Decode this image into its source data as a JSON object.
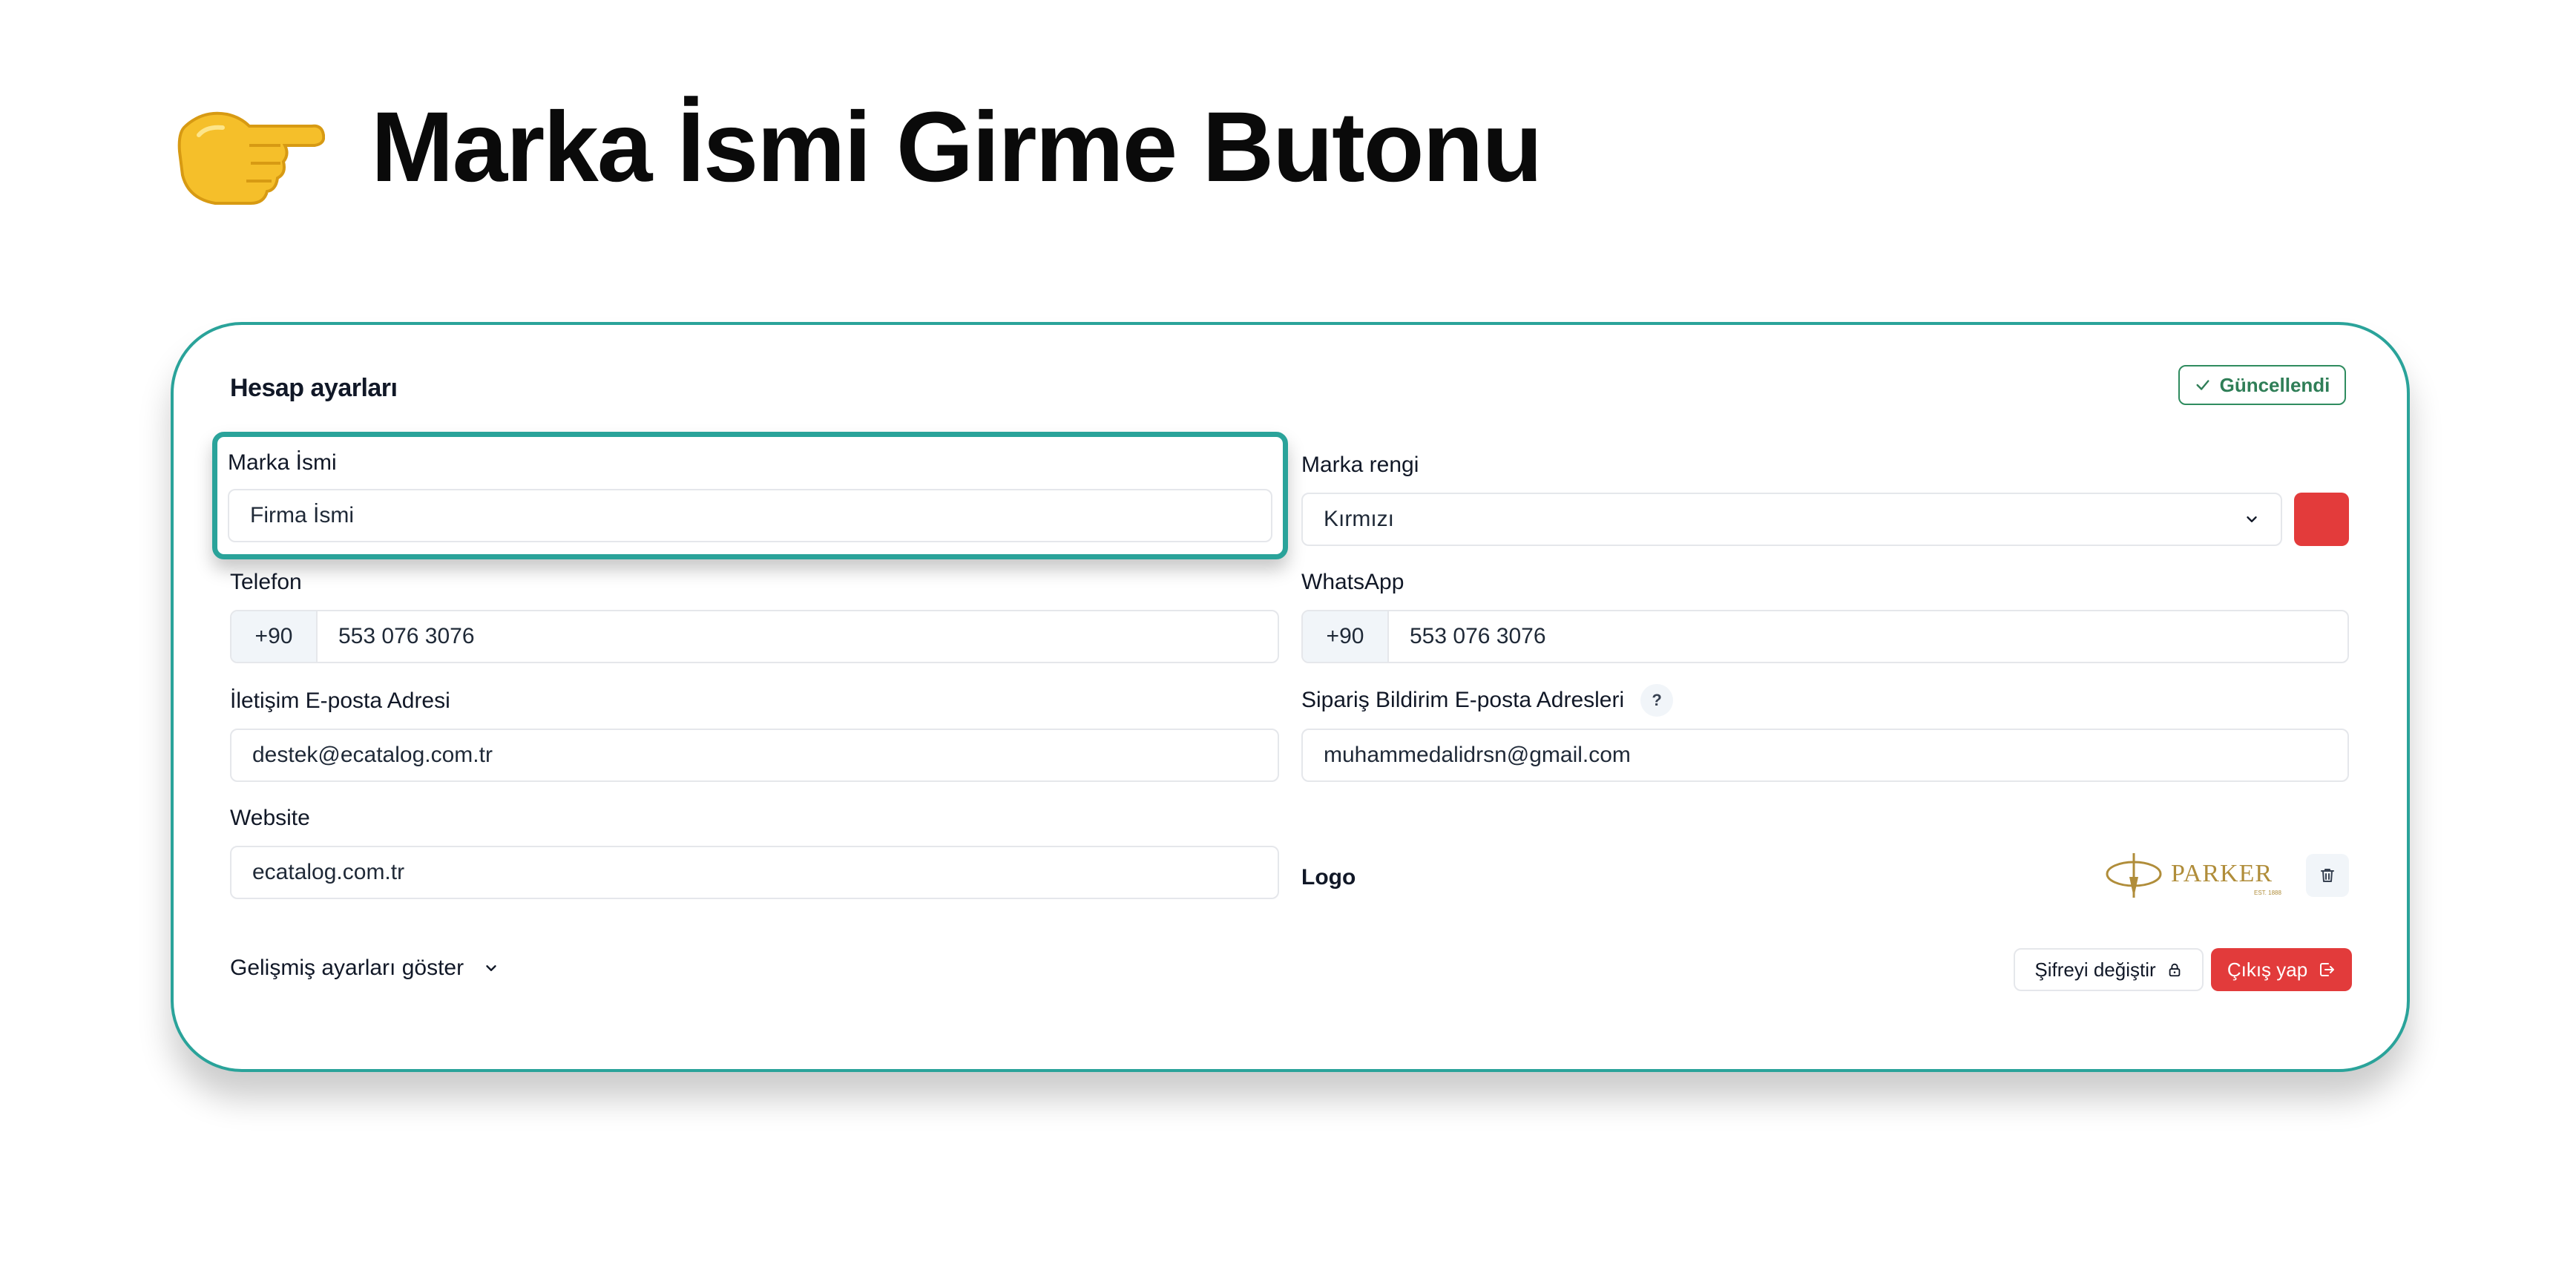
{
  "heading": {
    "icon": "pointing-hand-icon",
    "title": "Marka İsmi Girme Butonu"
  },
  "card": {
    "title": "Hesap ayarları",
    "updated_label": "Güncellendi",
    "accent_color": "#2aa39a"
  },
  "form": {
    "brand_name": {
      "label": "Marka İsmi",
      "value": "Firma İsmi"
    },
    "brand_color": {
      "label": "Marka rengi",
      "selected": "Kırmızı",
      "swatch_color": "#e33b3b"
    },
    "phone": {
      "label": "Telefon",
      "prefix": "+90",
      "value": "553 076 3076"
    },
    "whatsapp": {
      "label": "WhatsApp",
      "prefix": "+90",
      "value": "553 076 3076"
    },
    "contact_email": {
      "label": "İletişim E-posta Adresi",
      "value": "destek@ecatalog.com.tr"
    },
    "order_email": {
      "label": "Sipariş Bildirim E-posta Adresleri",
      "help": "?",
      "value": "muhammedalidrsn@gmail.com"
    },
    "website": {
      "label": "Website",
      "value": "ecatalog.com.tr"
    },
    "logo": {
      "label": "Logo",
      "brand_text": "PARKER",
      "brand_subtext": "EST. 1888"
    }
  },
  "footer": {
    "advanced_label": "Gelişmiş ayarları göster",
    "change_password_label": "Şifreyi değiştir",
    "logout_label": "Çıkış yap",
    "logout_color": "#e23b3b"
  }
}
